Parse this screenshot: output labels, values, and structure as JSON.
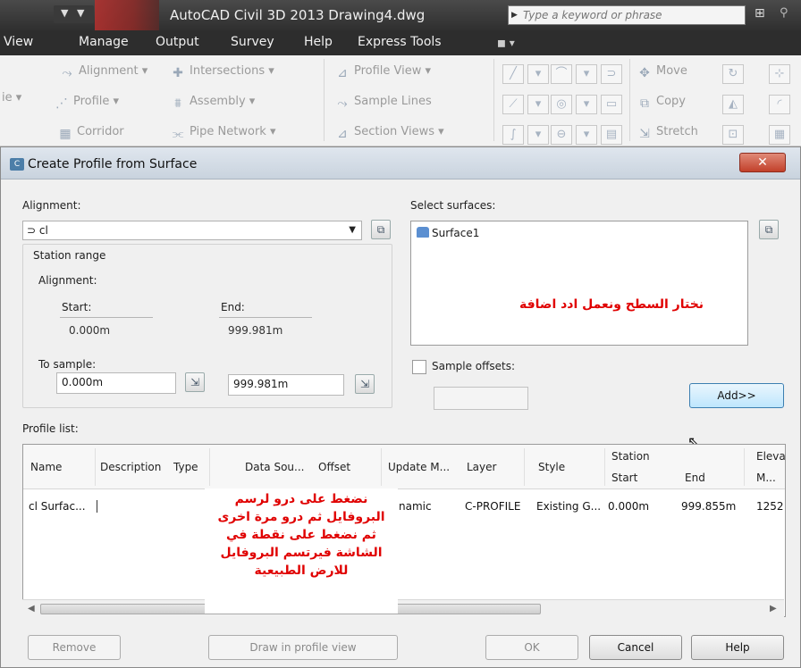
{
  "window": {
    "app_title": "AutoCAD Civil 3D 2013   Drawing4.dwg",
    "search_placeholder": "Type a keyword or phrase"
  },
  "menu": [
    "View",
    "Manage",
    "Output",
    "Survey",
    "Help",
    "Express Tools"
  ],
  "ribbon": {
    "col1": [
      "Alignment ▾",
      "Profile ▾",
      "Corridor"
    ],
    "col2": [
      "Intersections ▾",
      "Assembly ▾",
      "Pipe Network ▾"
    ],
    "col3": [
      "Profile View ▾",
      "Sample Lines",
      "Section Views ▾"
    ],
    "modify": [
      "Move",
      "Copy",
      "Stretch"
    ],
    "left_cut": "ie ▾"
  },
  "dialog": {
    "title": "Create Profile from Surface",
    "alignment_label": "Alignment:",
    "alignment_value": "cl",
    "station_range_label": "Station range",
    "alignment_sub_label": "Alignment:",
    "start_label": "Start:",
    "end_label": "End:",
    "start_value": "0.000m",
    "end_value": "999.981m",
    "to_sample_label": "To sample:",
    "sample_start": "0.000m",
    "sample_end": "999.981m",
    "select_surfaces_label": "Select surfaces:",
    "surfaces": [
      "Surface1"
    ],
    "sample_offsets_label": "Sample offsets:",
    "add_button": "Add>>",
    "profile_list_label": "Profile list:",
    "columns": [
      "Name",
      "Description",
      "Type",
      "Data Sou...",
      "Offset",
      "Update M...",
      "Layer",
      "Style",
      "Station",
      "Start",
      "End",
      "Eleva",
      "M..."
    ],
    "row": {
      "name": "cl Surfac...",
      "update_mode": "namic",
      "layer": "C-PROFILE",
      "style": "Existing G...",
      "start": "0.000m",
      "end": "999.855m",
      "elev": "1252"
    },
    "buttons": {
      "remove": "Remove",
      "draw": "Draw in profile view",
      "ok": "OK",
      "cancel": "Cancel",
      "help": "Help"
    }
  },
  "annotations": {
    "note_surface": "نختار السطح ونعمل ادد اضافة",
    "note_draw_lines": [
      "نضغط على درو لرسم",
      "البروفايل ثم درو مرة اخرى",
      "ثم نضغط على نقطة في",
      "الشاشة فيرتسم البروفايل",
      "للارض الطبيعية"
    ]
  },
  "icons": {
    "search": "triangle-icon",
    "binoculars": "binoculars-icon",
    "close": "close-icon",
    "pick": "pick-from-drawing-icon",
    "surface": "surface-icon"
  },
  "colors": {
    "annotation": "#e00000",
    "title_close": "#c2402a",
    "add_button": "#bee6fd"
  }
}
